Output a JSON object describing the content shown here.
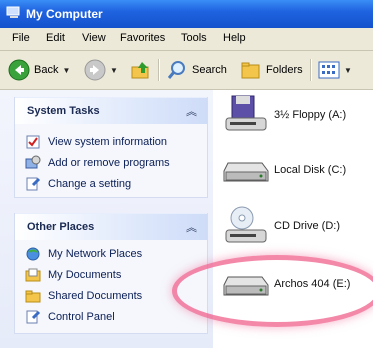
{
  "window": {
    "title": "My Computer"
  },
  "menu": [
    "File",
    "Edit",
    "View",
    "Favorites",
    "Tools",
    "Help"
  ],
  "toolbar": {
    "back": "Back",
    "search": "Search",
    "folders": "Folders"
  },
  "system_tasks": {
    "title": "System Tasks",
    "items": [
      "View system information",
      "Add or remove programs",
      "Change a setting"
    ]
  },
  "other_places": {
    "title": "Other Places",
    "items": [
      "My Network Places",
      "My Documents",
      "Shared Documents",
      "Control Panel"
    ]
  },
  "drives": [
    {
      "label": "3½ Floppy (A:)",
      "icon": "floppy-drive-icon"
    },
    {
      "label": "Local Disk (C:)",
      "icon": "hard-disk-icon"
    },
    {
      "label": "CD Drive (D:)",
      "icon": "cd-drive-icon"
    },
    {
      "label": "Archos 404 (E:)",
      "icon": "removable-disk-icon"
    }
  ],
  "colors": {
    "title_bar": "#1f63e0",
    "highlight": "#f0608c"
  }
}
